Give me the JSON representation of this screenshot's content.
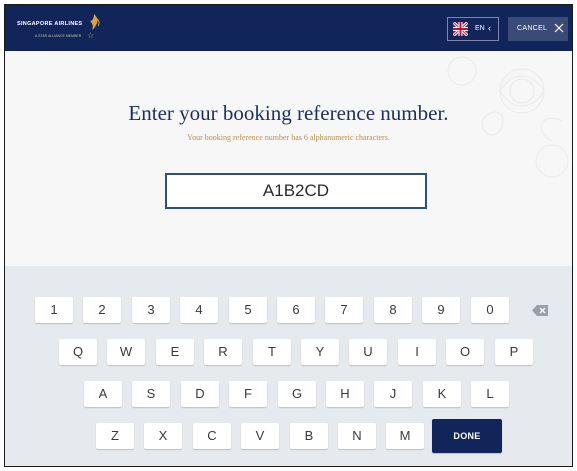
{
  "header": {
    "brand_name": "SINGAPORE AIRLINES",
    "brand_tagline": "A STAR ALLIANCE MEMBER",
    "language_label": "EN",
    "language_chevron": "‹",
    "cancel_label": "CANCEL",
    "colors": {
      "bar": "#11255a",
      "cancel_bg": "#3a4b78"
    }
  },
  "main": {
    "title": "Enter your booking reference number.",
    "subtitle": "Your booking reference number has 6 alphanumeric characters.",
    "input_value": "A1B2CD",
    "colors": {
      "title": "#1d2f5e",
      "subtitle": "#b8924a",
      "input_border": "#2a4f8f"
    }
  },
  "keyboard": {
    "row1": [
      "1",
      "2",
      "3",
      "4",
      "5",
      "6",
      "7",
      "8",
      "9",
      "0"
    ],
    "row2": [
      "Q",
      "W",
      "E",
      "R",
      "T",
      "Y",
      "U",
      "I",
      "O",
      "P"
    ],
    "row3": [
      "A",
      "S",
      "D",
      "F",
      "G",
      "H",
      "J",
      "K",
      "L"
    ],
    "row4": [
      "Z",
      "X",
      "C",
      "V",
      "B",
      "N",
      "M"
    ],
    "backspace_icon": "backspace-icon",
    "done_label": "DONE"
  }
}
